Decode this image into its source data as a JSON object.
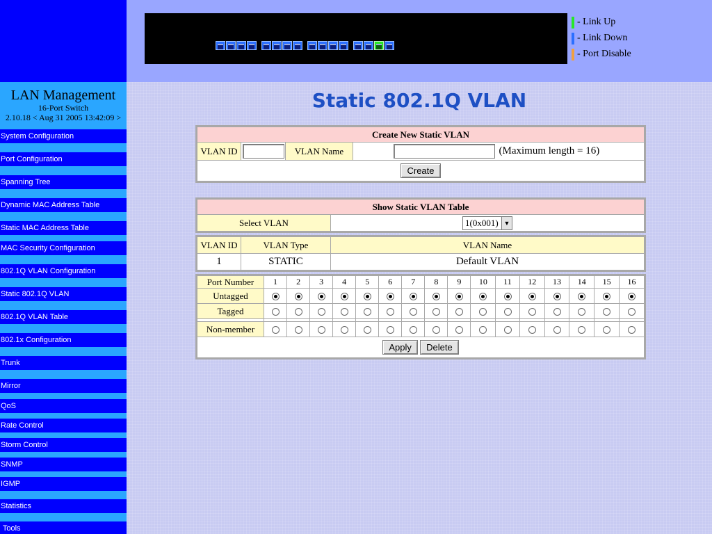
{
  "sidebar": {
    "brand_title": "LAN Management",
    "brand_model": "16-Port Switch",
    "brand_version": "2.10.18 < Aug 31 2005 13:42:09 >",
    "items": [
      {
        "label": "System Configuration"
      },
      {
        "label": "Port Configuration"
      },
      {
        "label": "Spanning Tree"
      },
      {
        "label": "Dynamic MAC Address Table"
      },
      {
        "label": "Static MAC Address Table"
      },
      {
        "label": "MAC Security Configuration"
      },
      {
        "label": "802.1Q VLAN Configuration"
      },
      {
        "label": "Static 802.1Q VLAN"
      },
      {
        "label": "802.1Q VLAN Table"
      },
      {
        "label": "802.1x Configuration"
      },
      {
        "label": "Trunk"
      },
      {
        "label": "Mirror"
      },
      {
        "label": "QoS"
      },
      {
        "label": "Rate Control"
      },
      {
        "label": "Storm Control"
      },
      {
        "label": "SNMP"
      },
      {
        "label": "IGMP"
      },
      {
        "label": "Statistics"
      },
      {
        "label": " Tools"
      }
    ]
  },
  "switch_panel": {
    "port_count": 16,
    "link_up_ports": [
      15
    ],
    "colors": {
      "link_up": "#27e827",
      "link_down": "#2b6fff",
      "port_disable": "#f0a040"
    }
  },
  "legend": [
    {
      "label": "- Link Up",
      "color": "#27e827"
    },
    {
      "label": "- Link Down",
      "color": "#2b6fff"
    },
    {
      "label": "- Port Disable",
      "color": "#f0a040"
    }
  ],
  "page": {
    "title": "Static 802.1Q VLAN"
  },
  "create_panel": {
    "header": "Create New Static VLAN",
    "vlan_id_label": "VLAN ID",
    "vlan_id_value": "",
    "vlan_name_label": "VLAN Name",
    "vlan_name_value": "",
    "max_length_note": "(Maximum length = 16)",
    "create_button": "Create"
  },
  "show_panel": {
    "header": "Show Static VLAN Table",
    "select_label": "Select VLAN",
    "select_value": "1(0x001)",
    "columns": {
      "vlan_id": "VLAN ID",
      "vlan_type": "VLAN Type",
      "vlan_name": "VLAN Name"
    },
    "row": {
      "vlan_id": "1",
      "vlan_type": "STATIC",
      "vlan_name": "Default VLAN"
    },
    "port_number_label": "Port Number",
    "ports": [
      "1",
      "2",
      "3",
      "4",
      "5",
      "6",
      "7",
      "8",
      "9",
      "10",
      "11",
      "12",
      "13",
      "14",
      "15",
      "16"
    ],
    "untagged_label": "Untagged",
    "tagged_label": "Tagged",
    "nonmember_label": "Non-member",
    "membership": [
      "untagged",
      "untagged",
      "untagged",
      "untagged",
      "untagged",
      "untagged",
      "untagged",
      "untagged",
      "untagged",
      "untagged",
      "untagged",
      "untagged",
      "untagged",
      "untagged",
      "untagged",
      "untagged"
    ],
    "apply_button": "Apply",
    "delete_button": "Delete"
  }
}
